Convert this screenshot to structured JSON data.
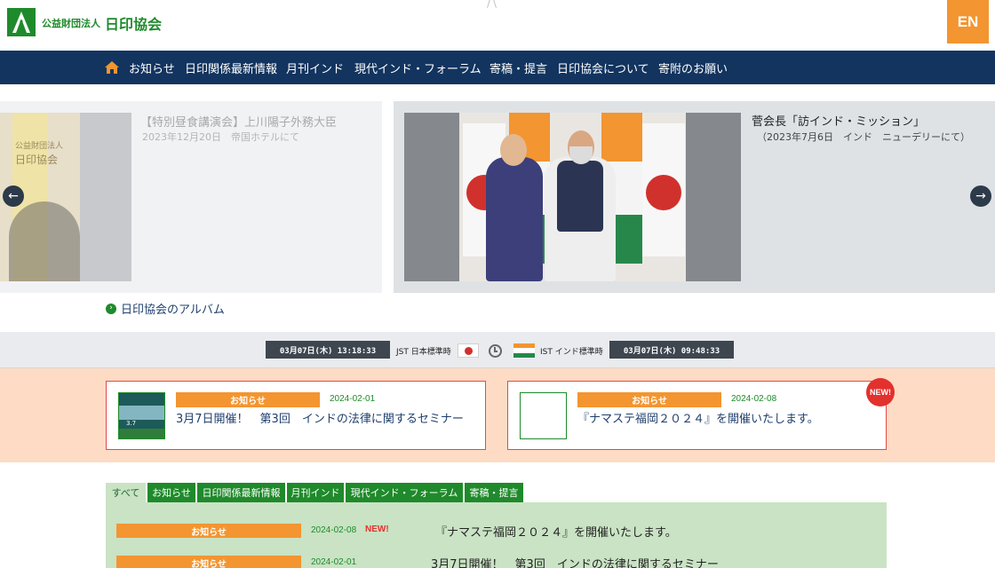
{
  "header": {
    "org_prefix": "公益財団法人",
    "org_name": "日印協会",
    "lang_button": "EN"
  },
  "nav": {
    "items": [
      "お知らせ",
      "日印関係最新情報",
      "月刊インド",
      "現代インド・フォーラム",
      "寄稿・提言",
      "日印協会について",
      "寄附のお願い"
    ]
  },
  "slider": {
    "prev": {
      "title": "【特別昼食講演会】上川陽子外務大臣",
      "subtitle": "2023年12月20日　帝国ホテルにて",
      "thumb_text_small": "公益財団法人",
      "thumb_text_big": "日印協会"
    },
    "current": {
      "title": "菅会長「訪インド・ミッション」",
      "subtitle": "（2023年7月6日　インド　ニューデリーにて）"
    }
  },
  "album_link": "日印協会のアルバム",
  "clock": {
    "jst_time": "03月07日(木) 13:18:33",
    "jst_label": "JST 日本標準時",
    "ist_label": "IST インド標準時",
    "ist_time": "03月07日(木) 09:48:33"
  },
  "featured": [
    {
      "badge": "お知らせ",
      "date": "2024-02-01",
      "text": "3月7日開催！　第3回　インドの法律に関するセミナー",
      "thumb_num": "3.7"
    },
    {
      "badge": "お知らせ",
      "date": "2024-02-08",
      "text": "『ナマステ福岡２０２４』を開催いたします。",
      "new": "NEW!"
    }
  ],
  "tabs": [
    "すべて",
    "お知らせ",
    "日印関係最新情報",
    "月刊インド",
    "現代インド・フォーラム",
    "寄稿・提言"
  ],
  "news_list": [
    {
      "badge": "お知らせ",
      "date": "2024-02-08",
      "new": "NEW!",
      "text": "『ナマステ福岡２０２４』を開催いたします。"
    },
    {
      "badge": "お知らせ",
      "date": "2024-02-01",
      "new": "",
      "text": "3月7日開催！　第3回　インドの法律に関するセミナー"
    }
  ],
  "colors": {
    "brand_green": "#1f8a2b",
    "nav_blue": "#12345f",
    "accent_orange": "#f39530",
    "new_red": "#e3312d"
  }
}
